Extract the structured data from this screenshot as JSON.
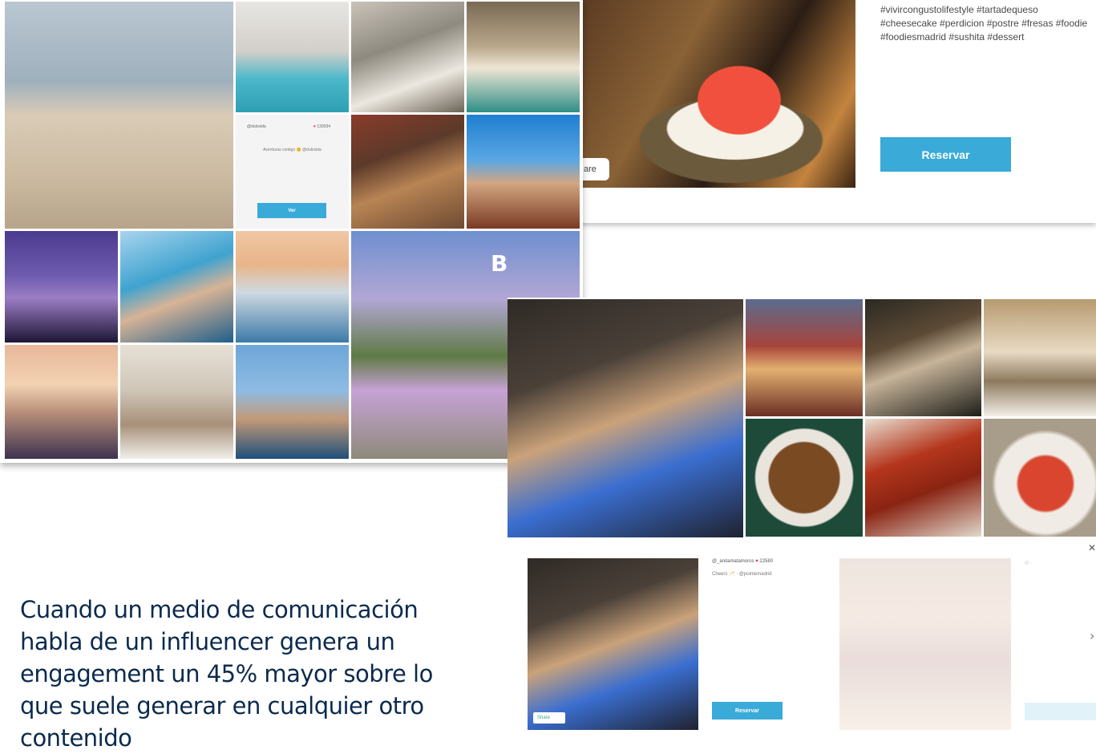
{
  "top_card": {
    "hashtags": "#vivircongustolifestyle #tartadequeso #cheesecake #perdicion #postre #fresas #foodie #foodiesmadrid #sushita #dessert",
    "share_label": "are",
    "reserve_label": "Reservar"
  },
  "collage": {
    "post": {
      "username": "@dulceida",
      "likes": "130034",
      "caption": "Aventuras contigo 😊 @dulceida",
      "button_label": "Ver"
    },
    "badge": "B"
  },
  "bottom_card": {
    "post": {
      "username": "@_anitamatamoros",
      "likes": "22580",
      "caption": "Cheers 🥂 · @pointemadrid",
      "share_label": "Share",
      "button_label": "Reservar"
    },
    "faded_text": "@...",
    "close_icon": "✕",
    "chevron_icon": "›"
  },
  "main_text": "Cuando un medio de comunicación habla de un influencer genera un engagement un 45% mayor sobre lo que suele generar en cualquier otro contenido"
}
